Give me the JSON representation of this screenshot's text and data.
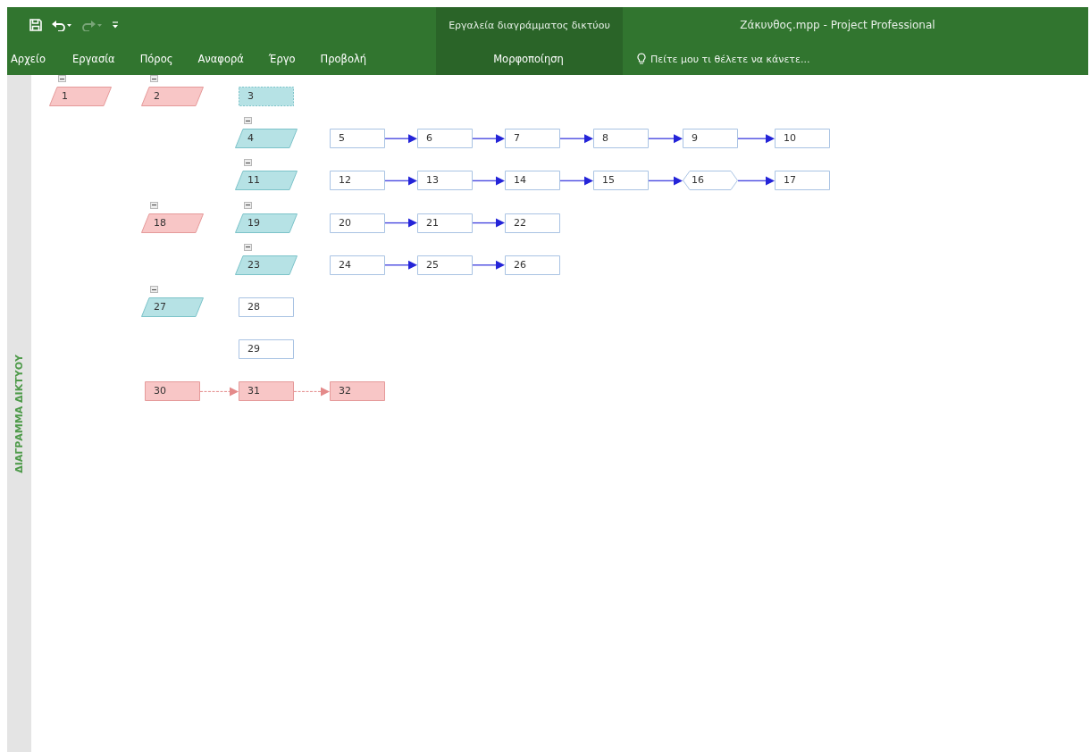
{
  "window": {
    "title": "Ζάκυνθος.mpp - Project Professional"
  },
  "quick_access": {
    "redo_disabled": true
  },
  "contextual_group": {
    "title": "Εργαλεία διαγράμματος δικτύου"
  },
  "ribbon_tabs": [
    {
      "label": "Αρχείο",
      "selected": false,
      "contextual": false
    },
    {
      "label": "Εργασία",
      "selected": false,
      "contextual": false
    },
    {
      "label": "Πόρος",
      "selected": false,
      "contextual": false
    },
    {
      "label": "Αναφορά",
      "selected": false,
      "contextual": false
    },
    {
      "label": "Έργο",
      "selected": false,
      "contextual": false
    },
    {
      "label": "Προβολή",
      "selected": false,
      "contextual": false
    },
    {
      "label": "Μορφοποίηση",
      "selected": false,
      "contextual": true
    }
  ],
  "tell_me": {
    "placeholder": "Πείτε μου τι θέλετε να κάνετε..."
  },
  "view_bar": {
    "label": "ΔΙΑΓΡΑΜΜΑ ΔΙΚΤΥΟΥ"
  },
  "network": {
    "nodes": [
      {
        "id": "1",
        "kind": "summary",
        "critical": true,
        "expanded": true,
        "children": [
          {
            "id": "2",
            "kind": "summary",
            "critical": true,
            "expanded": true,
            "children": [
              {
                "id": "3",
                "kind": "group",
                "critical": false
              },
              {
                "id": "4",
                "kind": "summary",
                "critical": false,
                "expanded": true,
                "children": [
                  {
                    "id": "5",
                    "kind": "task",
                    "critical": false,
                    "link": true
                  },
                  {
                    "id": "6",
                    "kind": "task",
                    "critical": false,
                    "link": true
                  },
                  {
                    "id": "7",
                    "kind": "task",
                    "critical": false,
                    "link": true
                  },
                  {
                    "id": "8",
                    "kind": "task",
                    "critical": false,
                    "link": true
                  },
                  {
                    "id": "9",
                    "kind": "task",
                    "critical": false,
                    "link": true
                  },
                  {
                    "id": "10",
                    "kind": "task",
                    "critical": false
                  }
                ]
              },
              {
                "id": "11",
                "kind": "summary",
                "critical": false,
                "expanded": true,
                "children": [
                  {
                    "id": "12",
                    "kind": "task",
                    "critical": false,
                    "link": true
                  },
                  {
                    "id": "13",
                    "kind": "task",
                    "critical": false,
                    "link": true
                  },
                  {
                    "id": "14",
                    "kind": "task",
                    "critical": false,
                    "link": true
                  },
                  {
                    "id": "15",
                    "kind": "task",
                    "critical": false,
                    "link": true
                  },
                  {
                    "id": "16",
                    "kind": "milestone",
                    "critical": false,
                    "link": true
                  },
                  {
                    "id": "17",
                    "kind": "task",
                    "critical": false
                  }
                ]
              }
            ]
          },
          {
            "id": "18",
            "kind": "summary",
            "critical": true,
            "expanded": true,
            "children": [
              {
                "id": "19",
                "kind": "summary",
                "critical": false,
                "expanded": true,
                "children": [
                  {
                    "id": "20",
                    "kind": "task",
                    "critical": false,
                    "link": true
                  },
                  {
                    "id": "21",
                    "kind": "task",
                    "critical": false,
                    "link": true
                  },
                  {
                    "id": "22",
                    "kind": "task",
                    "critical": false
                  }
                ]
              },
              {
                "id": "23",
                "kind": "summary",
                "critical": false,
                "expanded": true,
                "children": [
                  {
                    "id": "24",
                    "kind": "task",
                    "critical": false,
                    "link": true
                  },
                  {
                    "id": "25",
                    "kind": "task",
                    "critical": false,
                    "link": true
                  },
                  {
                    "id": "26",
                    "kind": "task",
                    "critical": false
                  }
                ]
              }
            ]
          },
          {
            "id": "27",
            "kind": "summary",
            "critical": false,
            "expanded": true,
            "children": [
              {
                "id": "28",
                "kind": "task",
                "critical": false
              },
              {
                "id": "29",
                "kind": "task",
                "critical": false
              }
            ]
          },
          {
            "id": "30",
            "kind": "task",
            "critical": true,
            "link": true
          },
          {
            "id": "31",
            "kind": "task",
            "critical": true,
            "link": true
          },
          {
            "id": "32",
            "kind": "task",
            "critical": true
          }
        ]
      }
    ]
  }
}
